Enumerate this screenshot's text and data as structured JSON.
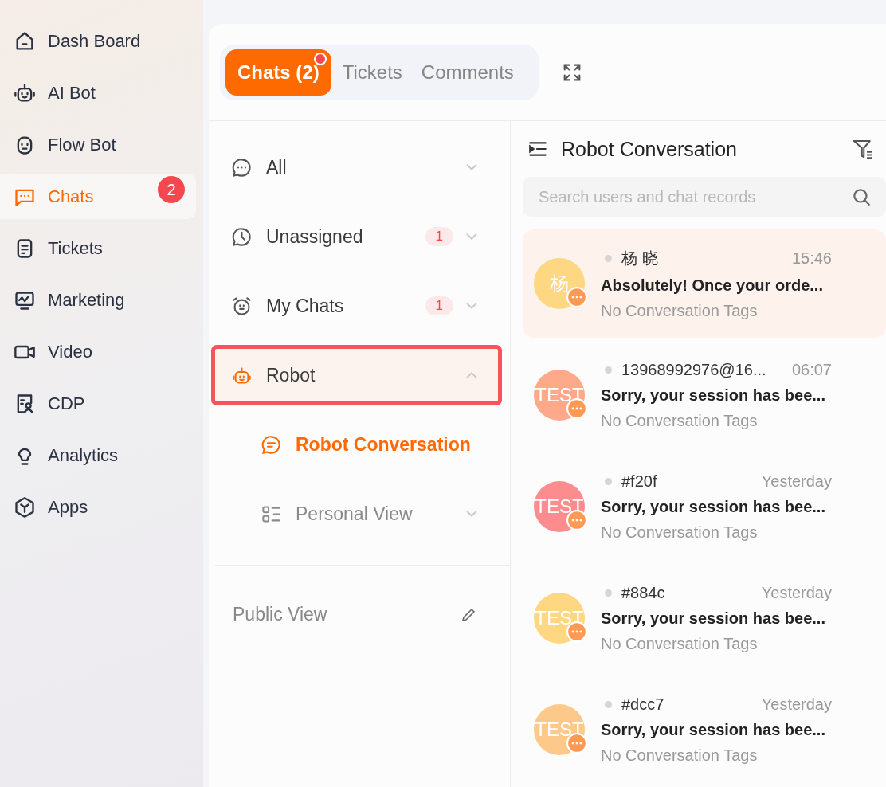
{
  "nav": [
    {
      "label": "Dash Board",
      "selected": false
    },
    {
      "label": "AI Bot",
      "selected": false
    },
    {
      "label": "Flow Bot",
      "selected": false
    },
    {
      "label": "Chats",
      "selected": true,
      "badge": "2"
    },
    {
      "label": "Tickets",
      "selected": false
    },
    {
      "label": "Marketing",
      "selected": false
    },
    {
      "label": "Video",
      "selected": false
    },
    {
      "label": "CDP",
      "selected": false
    },
    {
      "label": "Analytics",
      "selected": false
    },
    {
      "label": "Apps",
      "selected": false
    }
  ],
  "tabs": [
    {
      "label": "Chats (2)",
      "selected": true,
      "unread": true
    },
    {
      "label": "Tickets",
      "selected": false,
      "unread": false
    },
    {
      "label": "Comments",
      "selected": false,
      "unread": false
    }
  ],
  "views": [
    {
      "label": "All",
      "selected": false,
      "expanded": false,
      "highlighted": false
    },
    {
      "label": "Unassigned",
      "count": "1",
      "selected": false,
      "expanded": false,
      "highlighted": false
    },
    {
      "label": "My Chats",
      "count": "1",
      "selected": false,
      "expanded": false,
      "highlighted": false
    },
    {
      "label": "Robot",
      "selected": true,
      "expanded": true,
      "highlighted": true,
      "children": [
        {
          "label": "Robot Conversation",
          "selected": true,
          "expandable": false
        },
        {
          "label": "Personal View",
          "selected": false,
          "expandable": true
        }
      ]
    }
  ],
  "public_view": {
    "label": "Public View"
  },
  "list": {
    "title": "Robot Conversation",
    "search": {
      "placeholder": "Search users and chat records"
    },
    "conversations": [
      {
        "name": "杨 晓",
        "time": "15:46",
        "preview": "Absolutely! Once your orde...",
        "tags": "No Conversation Tags",
        "avatar": "杨",
        "color": "#fdd782",
        "online": false,
        "selected": true
      },
      {
        "name": "13968992976@16...",
        "time": "06:07",
        "preview": "Sorry, your session has bee...",
        "tags": "No Conversation Tags",
        "avatar": "TEST",
        "color": "#fda98a",
        "online": false,
        "selected": false
      },
      {
        "name": "#f20f",
        "time": "Yesterday",
        "preview": "Sorry, your session has bee...",
        "tags": "No Conversation Tags",
        "avatar": "TEST",
        "color": "#fd8c8f",
        "online": false,
        "selected": false
      },
      {
        "name": "#884c",
        "time": "Yesterday",
        "preview": "Sorry, your session has bee...",
        "tags": "No Conversation Tags",
        "avatar": "TEST",
        "color": "#fdd782",
        "online": false,
        "selected": false
      },
      {
        "name": "#dcc7",
        "time": "Yesterday",
        "preview": "Sorry, your session has bee...",
        "tags": "No Conversation Tags",
        "avatar": "TEST",
        "color": "#fdc98a",
        "online": false,
        "selected": false
      }
    ]
  }
}
